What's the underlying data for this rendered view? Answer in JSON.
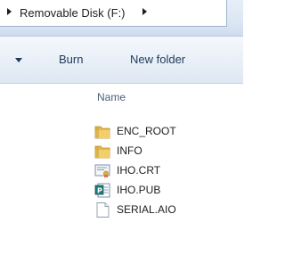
{
  "address": {
    "path": "Removable Disk (F:)"
  },
  "toolbar": {
    "burn_label": "Burn",
    "new_folder_label": "New folder"
  },
  "list": {
    "column_name": "Name",
    "items": [
      {
        "name": "ENC_ROOT",
        "icon": "folder-icon"
      },
      {
        "name": "INFO",
        "icon": "folder-icon"
      },
      {
        "name": "IHO.CRT",
        "icon": "certificate-icon"
      },
      {
        "name": "IHO.PUB",
        "icon": "publisher-file-icon"
      },
      {
        "name": "SERIAL.AIO",
        "icon": "blank-file-icon"
      }
    ]
  },
  "colors": {
    "folder": "#e8b84a",
    "toolbar_text": "#1e395b",
    "header_text": "#4c607a"
  }
}
